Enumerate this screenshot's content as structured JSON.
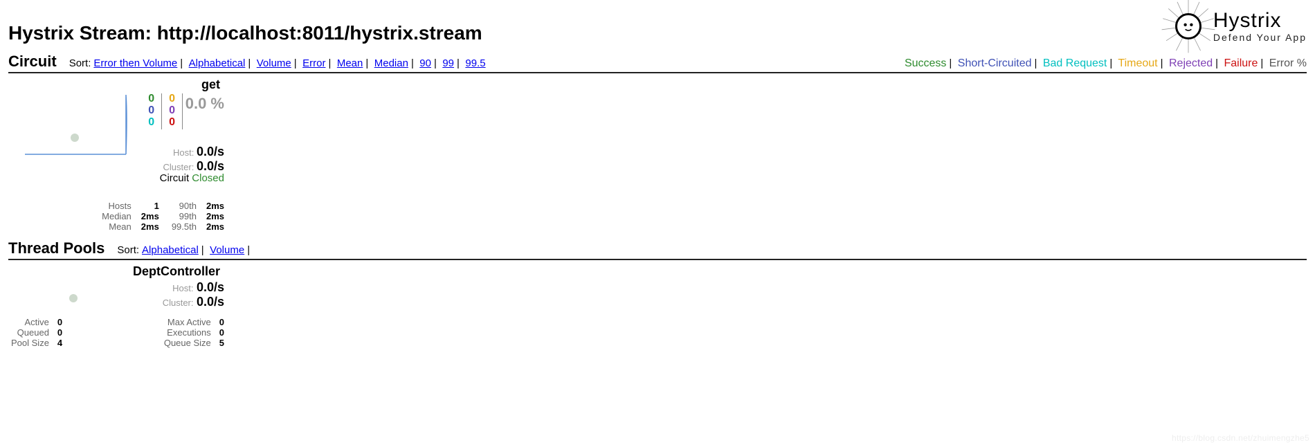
{
  "header": {
    "title": "Hystrix Stream: http://localhost:8011/hystrix.stream",
    "logo_title": "Hystrix",
    "logo_sub": "Defend Your App"
  },
  "circuit_section": {
    "title": "Circuit",
    "sort_label": "Sort:",
    "sort_links": [
      "Error then Volume",
      "Alphabetical",
      "Volume",
      "Error",
      "Mean",
      "Median",
      "90",
      "99",
      "99.5"
    ],
    "legend": {
      "success": "Success",
      "short": "Short-Circuited",
      "badreq": "Bad Request",
      "timeout": "Timeout",
      "reject": "Rejected",
      "fail": "Failure",
      "errpct": "Error %"
    }
  },
  "circuit": {
    "name": "get",
    "counts": {
      "col1": [
        "0",
        "0",
        "0"
      ],
      "col2": [
        "0",
        "0",
        "0"
      ]
    },
    "error_pct": "0.0 %",
    "host_label": "Host:",
    "host_rate": "0.0/s",
    "cluster_label": "Cluster:",
    "cluster_rate": "0.0/s",
    "circuit_label": "Circuit",
    "circuit_status": "Closed",
    "left_stats": [
      {
        "label": "Hosts",
        "value": "1"
      },
      {
        "label": "Median",
        "value": "2ms"
      },
      {
        "label": "Mean",
        "value": "2ms"
      }
    ],
    "right_stats": [
      {
        "label": "90th",
        "value": "2ms"
      },
      {
        "label": "99th",
        "value": "2ms"
      },
      {
        "label": "99.5th",
        "value": "2ms"
      }
    ]
  },
  "pool_section": {
    "title": "Thread Pools",
    "sort_label": "Sort:",
    "sort_links": [
      "Alphabetical",
      "Volume"
    ]
  },
  "pool": {
    "name": "DeptController",
    "host_label": "Host:",
    "host_rate": "0.0/s",
    "cluster_label": "Cluster:",
    "cluster_rate": "0.0/s",
    "left_stats": [
      {
        "label": "Active",
        "value": "0"
      },
      {
        "label": "Queued",
        "value": "0"
      },
      {
        "label": "Pool Size",
        "value": "4"
      }
    ],
    "right_stats": [
      {
        "label": "Max Active",
        "value": "0"
      },
      {
        "label": "Executions",
        "value": "0"
      },
      {
        "label": "Queue Size",
        "value": "5"
      }
    ]
  },
  "watermark": "https://blog.csdn.net/zhuimengzhe5"
}
